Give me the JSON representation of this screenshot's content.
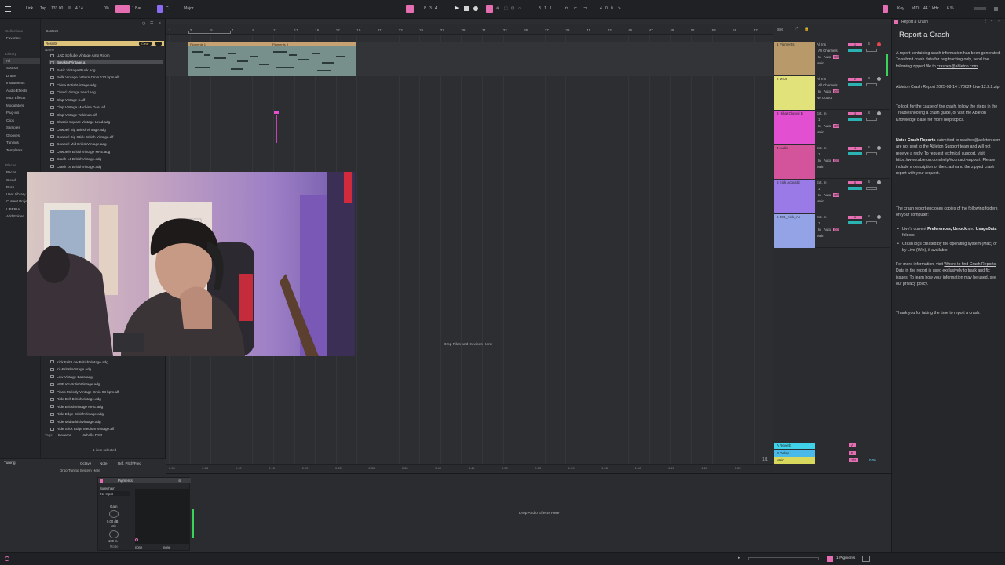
{
  "topbar": {
    "link": "Link",
    "tap": "Tap",
    "tempo": "133.00",
    "sig": "4 / 4",
    "pct": "0%",
    "quant": "1 Bar",
    "key": "C",
    "scale": "Major",
    "position": "8 . 3 . 4",
    "loop_start": "3 . 1 . 1",
    "loop_len": "4 . 0 . 0",
    "key_label": "Key",
    "midi_label": "MIDI",
    "sample_rate": "44.1 kHz",
    "cpu": "6 %",
    "colors": {
      "accent_pink": "#e56eb3",
      "accent_purple": "#8a6cf0"
    }
  },
  "browser": {
    "search": "vintage",
    "collections_label": "Collections",
    "favorites": "Favorites",
    "library_label": "Library",
    "library_items": [
      "All",
      "Sounds",
      "Drums",
      "Instruments",
      "Audio Effects",
      "MIDI Effects",
      "Modulators",
      "Plug-ins",
      "Clips",
      "Samples",
      "Grooves",
      "Tunings",
      "Templates"
    ],
    "places_label": "Places",
    "places_items": [
      "Packs",
      "Cloud",
      "Push",
      "User Library",
      "Current Project",
      "LIBERIA",
      "Add Folder..."
    ],
    "content_label": "Content",
    "results_label": "Results",
    "clear_label": "Clear",
    "name_col": "Name",
    "results_top": [
      "UAD Softube Vintage Amp Room",
      "BreakIntVintage.a",
      "Basic Vintage Pluck.adg",
      "Bells Vintage pattern Cmin 132 bpm.alf",
      "China BritishVintage.adg",
      "Chord Vintage Lead.adg",
      "Clap Vintage 5.alf",
      "Clap Vintage Machine Duet.alf",
      "Clap Vintage Yakimas.alf",
      "Classic Square Vintage Lead.adg",
      "Cowbell Big BritishVintage.adg",
      "Cowbell Big Stick British Vintage.alf",
      "Cowbell Mid BritishVintage.adg",
      "Cowbells BritishVintage MPE.adg",
      "Crash 14 BritishVintage.adg",
      "Crash 16 BritishVintage.adg"
    ],
    "results_bottom": [
      "Kick Felt Hard Vintage.alf",
      "Kick Felt Low BritishVintage.adg",
      "Kit-BritishVintage.adg",
      "Low Vintage Bass.adg",
      "MPE Kit-BritishVintage.adg",
      "Piano Melody Vintage Dmin 93 bpm.alf",
      "Ride Bell BritishVintage.adg",
      "Ride BritishVintage MPE.adg",
      "Ride Edge BritishVintage.adg",
      "Ride Mid BritishVintage.adg",
      "Ride Stick Edge Medium Vintage.alf"
    ],
    "tags_label": "Tags:",
    "tag1": "Reverbs",
    "tag2": "Valhalla DSP",
    "selected_status": "1 item selected"
  },
  "arrangement": {
    "ruler": [
      "1",
      "3",
      "5",
      "7",
      "9",
      "11",
      "13",
      "15",
      "17",
      "19",
      "21",
      "23",
      "25",
      "27",
      "29",
      "31",
      "33",
      "35",
      "37",
      "39",
      "41",
      "43",
      "45",
      "47",
      "49",
      "51",
      "53",
      "55",
      "57"
    ],
    "clip1": "Pigments 1",
    "clip2": "Pigments 3",
    "drop_hint": "Drop Files and Devices Here",
    "timeline": [
      "0:00",
      "0:05",
      "0:10",
      "0:15",
      "0:20",
      "0:25",
      "0:30",
      "0:35",
      "0:40",
      "0:45",
      "0:50",
      "0:55",
      "1:00",
      "1:05",
      "1:10",
      "1:15",
      "1:20",
      "1:25"
    ],
    "set_label": "Set",
    "page_indicator": "1/1"
  },
  "tracks": [
    {
      "name": "1 Pigments",
      "color": "#b89a6a",
      "input": "All Ins",
      "channel": "All Channels",
      "output": "Main",
      "num": "1"
    },
    {
      "name": "2 MIDI",
      "color": "#e2e27a",
      "input": "All Ins",
      "channel": "All Channels",
      "output": "No Output",
      "num": "2"
    },
    {
      "name": "3 Hihat Closed B",
      "color": "#e34fd1",
      "input": "Ext. In",
      "channel": "1",
      "output": "Main",
      "num": "3"
    },
    {
      "name": "4 Audio",
      "color": "#d4549c",
      "input": "Ext. In",
      "channel": "1",
      "output": "Main",
      "num": "4"
    },
    {
      "name": "5 Kick Acoustic",
      "color": "#9a7ae6",
      "input": "Ext. In",
      "channel": "1",
      "output": "Main",
      "num": "5"
    },
    {
      "name": "6 808_Kick_An",
      "color": "#93a3e6",
      "input": "Ext. In",
      "channel": "1",
      "output": "Main",
      "num": "6"
    }
  ],
  "returns": [
    {
      "name": "A Reverb",
      "color": "#3fd2e8",
      "letter": "A"
    },
    {
      "name": "B Delay",
      "color": "#48b9e9",
      "letter": "B"
    },
    {
      "name": "Main",
      "color": "#d8d85c",
      "letter": "1/2"
    }
  ],
  "mixer_labels": {
    "in": "In",
    "auto": "Auto",
    "off": "Off",
    "s": "S",
    "master_vol": "0.00"
  },
  "report": {
    "header": "Report a Crash",
    "title": "Report a Crash",
    "p1": "A report containing crash information has been generated. To submit crash data for bug tracking only, send the following zipped file to",
    "email1": "crashes@ableton.com",
    "file": "Ableton Crash Report 2025-08-14 170824 Live 12.2.2.zip",
    "p2a": "To look for the cause of the crash, follow the steps in the",
    "link_guide": "Troubleshooting a crash",
    "p2b": "guide, or visit the",
    "link_kb": "Ableton Knowledge Base",
    "p2c": "for more help topics.",
    "note_label": "Note:",
    "note_bold": "Crash Reports",
    "p3a": "submitted to crashes@ableton.com are not sent to the Ableton Support team and will not receive a reply. To request technical support, visit",
    "link_support": "https://www.ableton.com/help/#contact-support",
    "p3b": ". Please include a description of the crash and the zipped crash report with your request.",
    "p4": "The crash report encloses copies of the following folders on your computer:",
    "bullet1a": "Live's current",
    "bullet1b": "Preferences, Unlock",
    "bullet1c": "and",
    "bullet1d": "UsageData",
    "bullet1e": "folders",
    "bullet2": "Crash logs created by the operating system (Mac) or by Live (Win), if available",
    "p5a": "For more information, visit",
    "link_find": "Where to find Crash Reports",
    "p5b": ". Data in the report is used exclusively to track and fix issues. To learn how your information may be used, see our",
    "link_privacy": "privacy policy",
    "p6": "Thank you for taking the time to report a crash."
  },
  "bottom": {
    "tuning_label": "Tuning",
    "octave": "Octave",
    "note": "Note",
    "ref": "Ref. Pitch/Freq",
    "drop_tuning": "Drop Tuning System Here",
    "device_name": "Pigments",
    "sidechain": "Sidechain",
    "no_input": "No Input",
    "gain": "Gain",
    "gain_val": "0.00 dB",
    "mix": "Mix",
    "mix_val": "100 %",
    "mode": "Mode",
    "none1": "none",
    "none2": "none",
    "drop_effects": "Drop Audio Effects Here",
    "status_track": "1-Pigments"
  }
}
